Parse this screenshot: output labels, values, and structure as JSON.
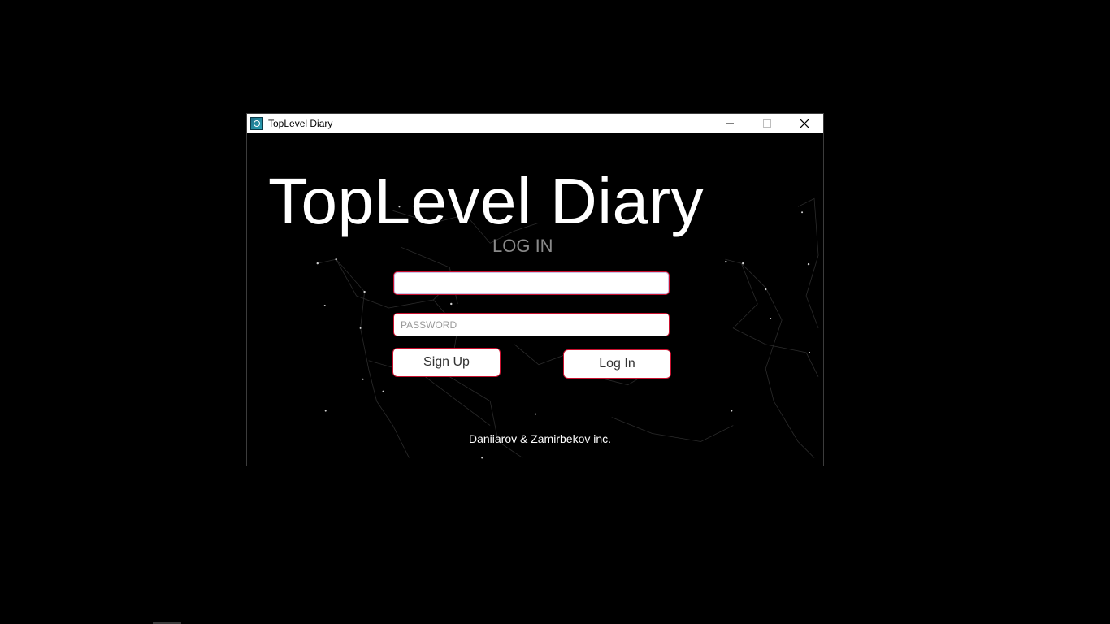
{
  "window": {
    "title": "TopLevel Diary",
    "controls": [
      "minimize",
      "maximize",
      "close"
    ]
  },
  "main": {
    "app_title": "TopLevel Diary",
    "subtitle": "LOG IN",
    "username": {
      "value": "",
      "placeholder": ""
    },
    "password": {
      "value": "",
      "placeholder": "PASSWORD"
    },
    "signup_label": "Sign Up",
    "login_label": "Log In",
    "footer": "Daniiarov & Zamirbekov inc."
  },
  "colors": {
    "background": "#000000",
    "accent_border": "#c8102e",
    "title_text": "#ffffff",
    "subtitle_text": "#8a8a8a"
  },
  "icons": {
    "app": "app-icon",
    "minimize": "minimize-icon",
    "maximize": "maximize-icon",
    "close": "close-icon"
  }
}
